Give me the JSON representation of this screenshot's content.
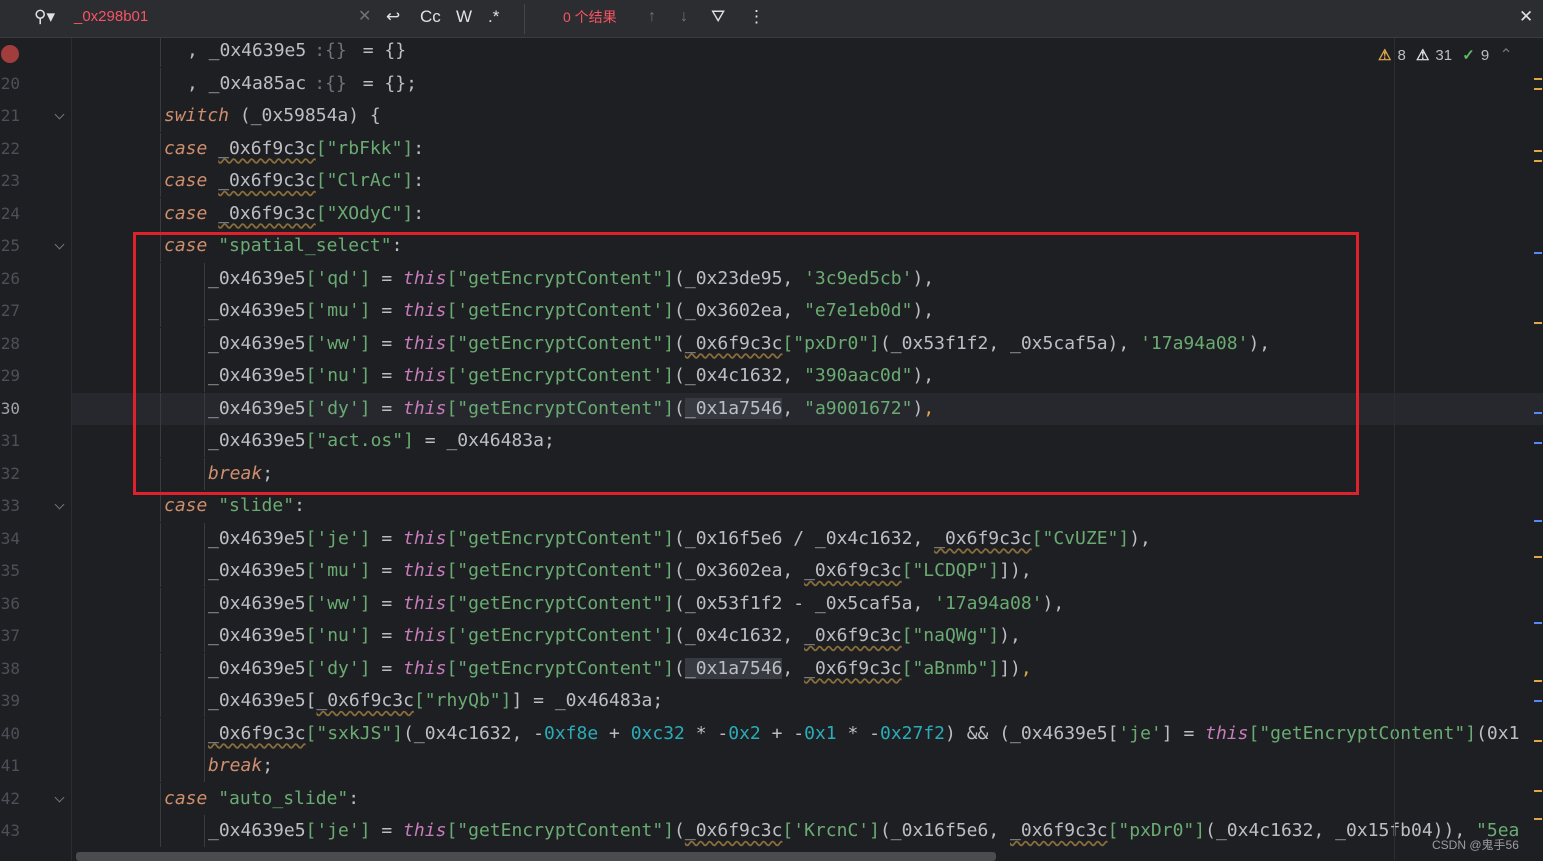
{
  "search": {
    "query": "_0x298b01",
    "results": "0 个结果",
    "match_case": "Cc",
    "words": "W",
    "regex": ".*"
  },
  "inspections": {
    "warnings": "8",
    "weak_warnings": "31",
    "typos": "9"
  },
  "gutter": {
    "line_numbers": [
      "20",
      "21",
      "22",
      "23",
      "24",
      "25",
      "26",
      "27",
      "28",
      "29",
      "30",
      "31",
      "32",
      "33",
      "34",
      "35",
      "36",
      "37",
      "38",
      "39",
      "40",
      "41",
      "42",
      "43"
    ],
    "current_line": "30"
  },
  "code": {
    "l19_a": ", _0x4639e5",
    "l19_b": ":{}",
    "l19_c": "= {}",
    "l20_a": ", _0x4a85ac",
    "l20_b": ":{}",
    "l20_c": "= {};",
    "kw_switch": "switch",
    "l21_rest": " (_0x59854a) {",
    "kw_case": "case",
    "obj_a": "_0x6f9c3c",
    "s_rbFkk": "[\"rbFkk\"]",
    "s_ClrAc": "[\"ClrAc\"]",
    "s_XOdyC": "[\"XOdyC\"]",
    "colon": ":",
    "s_spatial": "\"spatial_select\"",
    "target": "_0x4639e5",
    "k_qd": "['qd']",
    "k_mu": "['mu']",
    "k_ww": "['ww']",
    "k_nu": "['nu']",
    "k_dy": "['dy']",
    "k_je": "['je']",
    "k_act": "[\"act.os\"]",
    "eq": " = ",
    "kw_this": "this",
    "gec_d": "[\"getEncryptContent\"]",
    "gec_s": "['getEncryptContent']",
    "l26_args": "(_0x23de95, ",
    "l26_s": "'3c9ed5cb'",
    "l26_end": "),",
    "l27_args": "(_0x3602ea, ",
    "l27_s": "\"e7e1eb0d\"",
    "l27_end": "),",
    "l28_open": "(",
    "l28_key": "[\"pxDr0\"]",
    "l28_mid": "(_0x53f1f2, _0x5caf5a), ",
    "l28_s": "'17a94a08'",
    "l28_end": "),",
    "l29_args": "(_0x4c1632, ",
    "l29_s": "\"390aac0d\"",
    "l29_end": "),",
    "l30_var": "_0x1a7546",
    "l30_sep": ", ",
    "l30_s": "\"a9001672\"",
    "l30_end": ")",
    "l31_rest": " = _0x46483a;",
    "kw_break": "break",
    "semi": ";",
    "s_slide": "\"slide\"",
    "l34_args": "(_0x16f5e6 / _0x4c1632, ",
    "l34_key": "[\"CvUZE\"]",
    "l34_end": "),",
    "l35_args": "(_0x3602ea, ",
    "l35_key": "[\"LCDQP\"]",
    "l35_end": "]),",
    "l36_args": "(_0x53f1f2 - _0x5caf5a, ",
    "l36_s": "'17a94a08'",
    "l36_end": "),",
    "l37_args": "(_0x4c1632, ",
    "l37_key": "[\"naQWg\"]",
    "l37_end": "),",
    "l38_key": "[\"aBnmb\"]",
    "l38_end": "])",
    "l39_key": "[\"rhyQb\"]",
    "l39_rest": "] = _0x46483a;",
    "l40_key": "[\"sxkJS\"]",
    "l40_a": "(_0x4c1632, -",
    "l40_n1": "0xf8e",
    "l40_p": " + ",
    "l40_n2": "0xc32",
    "l40_m": " * -",
    "l40_n3": "0x2",
    "l40_p2": " + -",
    "l40_n4": "0x1",
    "l40_m2": " * -",
    "l40_n5": "0x27f2",
    "l40_b": ") && (_0x4639e5[",
    "l40_je": "'je'",
    "l40_c": "] = ",
    "l40_tail": "(0x1",
    "s_auto": "\"auto_slide\"",
    "l43_open": "(",
    "l43_key": "['KrcnC']",
    "l43_mid": "(_0x16f5e6, ",
    "l43_key2": "[\"pxDr0\"]",
    "l43_rest": "(_0x4c1632, _0x15fb04)), ",
    "l43_s": "\"5ea"
  },
  "watermark": "CSDN @鬼手56"
}
